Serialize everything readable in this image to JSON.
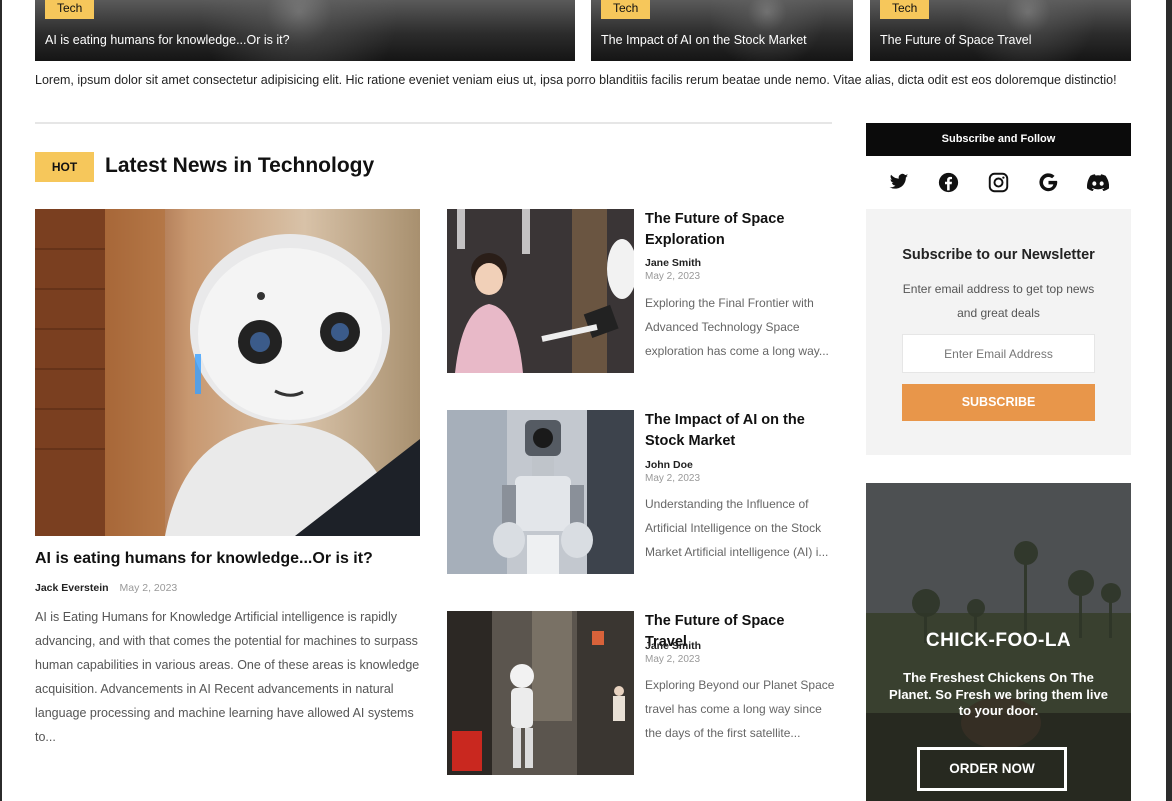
{
  "top_cards": [
    {
      "tag": "Tech",
      "caption": "AI is eating humans for knowledge...Or is it?"
    },
    {
      "tag": "Tech",
      "caption": "The Impact of AI on the Stock Market"
    },
    {
      "tag": "Tech",
      "caption": "The Future of Space Travel"
    }
  ],
  "intro_text": "Lorem, ipsum dolor sit amet consectetur adipisicing elit. Hic ratione eveniet veniam eius ut, ipsa porro blanditiis facilis rerum beatae unde nemo. Vitae alias, dicta odit est eos doloremque distinctio!",
  "section": {
    "badge": "HOT",
    "title": "Latest News in Technology"
  },
  "featured": {
    "title": "AI is eating humans for knowledge...Or is it?",
    "author": "Jack Everstein",
    "date": "May 2, 2023",
    "excerpt": "AI is Eating Humans for Knowledge Artificial intelligence is rapidly advancing, and with that comes the potential for machines to surpass human capabilities in various areas. One of these areas is knowledge acquisition. Advancements in AI Recent advancements in natural language processing and machine learning have allowed AI systems to..."
  },
  "articles": [
    {
      "title": "The Future of Space Exploration",
      "author": "Jane Smith",
      "date": "May 2, 2023",
      "excerpt": "Exploring the Final Frontier with Advanced Technology Space exploration has come a long way..."
    },
    {
      "title": "The Impact of AI on the Stock Market",
      "author": "John Doe",
      "date": "May 2, 2023",
      "excerpt": "Understanding the Influence of Artificial Intelligence on the Stock Market Artificial intelligence (AI) i..."
    },
    {
      "title": "The Future of Space Travel",
      "author": "Jane Smith",
      "date": "May 2, 2023",
      "excerpt": "Exploring Beyond our Planet Space travel has come a long way since the days of the first satellite..."
    }
  ],
  "sidebar": {
    "follow_heading": "Subscribe and Follow",
    "social_icons": [
      "twitter-icon",
      "facebook-icon",
      "instagram-icon",
      "google-icon",
      "discord-icon"
    ],
    "newsletter": {
      "title": "Subscribe to our Newsletter",
      "text": "Enter email address to get top news and great deals",
      "placeholder": "Enter Email Address",
      "button": "SUBSCRIBE"
    },
    "ad": {
      "brand": "CHICK-FOO-LA",
      "tagline": "The Freshest Chickens On The Planet. So Fresh we bring them live to your door.",
      "button": "ORDER NOW"
    }
  },
  "colors": {
    "accent_yellow": "#f6c75b",
    "subscribe_orange": "#e8964a",
    "dark": "#0b0b0b"
  }
}
